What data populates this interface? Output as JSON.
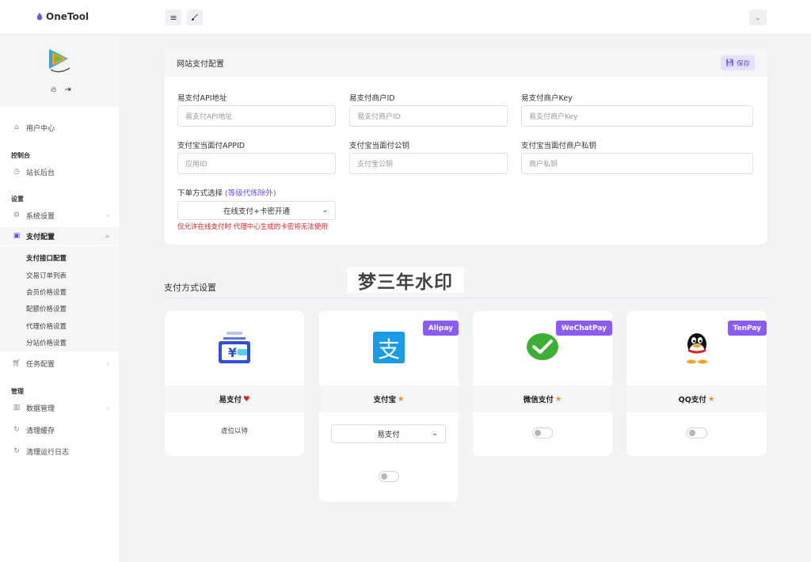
{
  "header": {
    "brand": "OneTool",
    "menu_icon": "hamburger-icon",
    "brush_icon": "brush-icon",
    "user_dropdown_icon": "chevron-down-icon"
  },
  "sidebar": {
    "profile_icons": [
      "flame-icon",
      "logout-icon"
    ],
    "items": {
      "user_center": "用户中心",
      "section_console": "控制台",
      "admin": "站长后台",
      "section_settings": "设置",
      "system": "系统设置",
      "pay_config": "支付配置",
      "sub": [
        "支付接口配置",
        "交易订单列表",
        "会员价格设置",
        "配额价格设置",
        "代理价格设置",
        "分站价格设置"
      ],
      "task": "任务配置",
      "section_manage": "管理",
      "data": "数据管理",
      "clear_cache": "清理缓存",
      "clear_log": "清理运行日志"
    }
  },
  "config": {
    "title": "网站支付配置",
    "save": "保存",
    "fields": {
      "epay_api": {
        "label": "易支付API地址",
        "placeholder": "易支付API地址"
      },
      "epay_mid": {
        "label": "易支付商户ID",
        "placeholder": "易支付商户ID"
      },
      "epay_key": {
        "label": "易支付商户Key",
        "placeholder": "易支付商户Key"
      },
      "ali_appid": {
        "label": "支付宝当面付APPID",
        "placeholder": "应用ID"
      },
      "ali_pub": {
        "label": "支付宝当面付公钥",
        "placeholder": "支付宝公钥"
      },
      "ali_priv": {
        "label": "支付宝当面付商户私钥",
        "placeholder": "商户私钥"
      }
    },
    "order_label": "下单方式选择",
    "order_note": "(等级代练除外)",
    "order_value": "在线支付+卡密开通",
    "hint": "仅允许在线支付时 代理中心生成的卡密将无法使用"
  },
  "methods": {
    "title": "支付方式设置",
    "watermark": "梦三年水印",
    "cards": [
      {
        "name": "易支付",
        "mark": "heart-icon",
        "badge": "",
        "text": "虚位以待"
      },
      {
        "name": "支付宝",
        "mark": "star-icon",
        "badge": "Alipay",
        "select": "易支付"
      },
      {
        "name": "微信支付",
        "mark": "star-icon",
        "badge": "WeChatPay"
      },
      {
        "name": "QQ支付",
        "mark": "star-icon",
        "badge": "TenPay"
      }
    ]
  },
  "colors": {
    "accent": "#8a5cf5",
    "danger": "#dd2222",
    "heart": "#e02020",
    "star": "#f08a1c"
  }
}
